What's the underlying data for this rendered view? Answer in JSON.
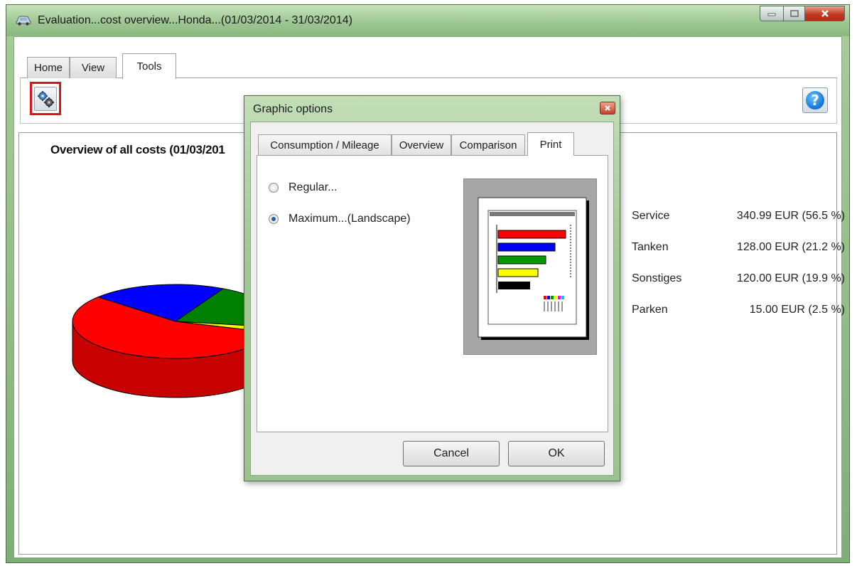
{
  "window": {
    "title": "Evaluation...cost overview...Honda...(01/03/2014 - 31/03/2014)",
    "icon": "car-icon"
  },
  "tabs": [
    {
      "label": "Home"
    },
    {
      "label": "View"
    },
    {
      "label": "Tools"
    }
  ],
  "toolbar": {
    "settings_icon": "gears-icon",
    "help_icon_glyph": "?"
  },
  "chart_panel": {
    "title": "Overview of all costs (01/03/201"
  },
  "chart_data": {
    "type": "pie",
    "categories": [
      "Service",
      "Tanken",
      "Sonstiges",
      "Parken"
    ],
    "values": [
      340.99,
      128.0,
      120.0,
      15.0
    ],
    "labels": [
      "340.99 EUR (56.5 %)",
      "128.00 EUR (21.2 %)",
      "120.00 EUR (19.9 %)",
      "15.00 EUR (2.5 %)"
    ],
    "colors": [
      "#ff0000",
      "#0000ff",
      "#008000",
      "#ffff00"
    ],
    "style": "3d",
    "legend": "right"
  },
  "dialog": {
    "title": "Graphic options",
    "tabs": [
      {
        "label": "Consumption / Mileage"
      },
      {
        "label": "Overview"
      },
      {
        "label": "Comparison"
      },
      {
        "label": "Print"
      }
    ],
    "options": [
      {
        "label": "Regular...",
        "checked": false
      },
      {
        "label": "Maximum...(Landscape)",
        "checked": true
      }
    ],
    "cancel_label": "Cancel",
    "ok_label": "OK"
  },
  "colors": {
    "frame": "#9cc38f",
    "highlight_border": "#e0101c"
  }
}
